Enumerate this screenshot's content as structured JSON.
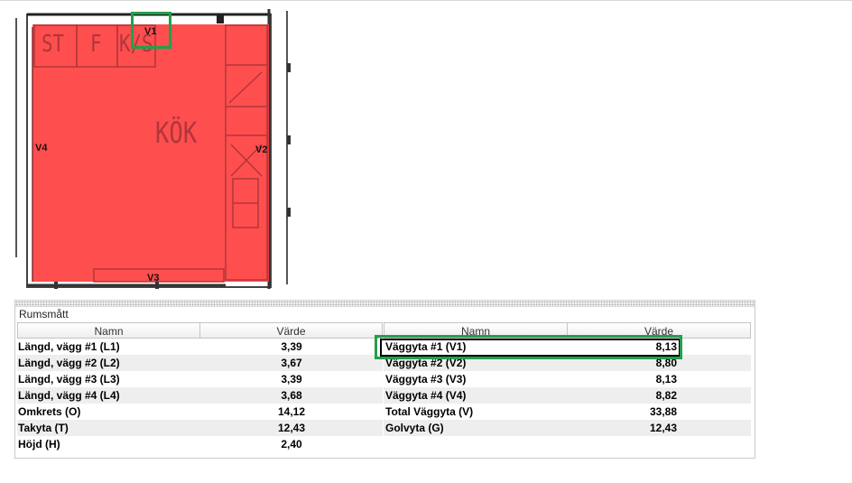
{
  "floorplan": {
    "room_label": "KÖK",
    "top_labels": [
      "ST",
      "F",
      "K/S"
    ],
    "wall_labels": {
      "v1": "V1",
      "v2": "V2",
      "v3": "V3",
      "v4": "V4"
    },
    "fill_color": "#ff3b3b",
    "highlight_color": "#22a04a"
  },
  "panel": {
    "title": "Rumsmått",
    "left_table": {
      "headers": [
        "Namn",
        "Värde"
      ],
      "rows": [
        {
          "name": "Längd, vägg #1 (L1)",
          "value": "3,39"
        },
        {
          "name": "Längd, vägg #2 (L2)",
          "value": "3,67"
        },
        {
          "name": "Längd, vägg #3 (L3)",
          "value": "3,39"
        },
        {
          "name": "Längd, vägg #4 (L4)",
          "value": "3,68"
        },
        {
          "name": "Omkrets (O)",
          "value": "14,12"
        },
        {
          "name": "Takyta (T)",
          "value": "12,43"
        },
        {
          "name": "Höjd (H)",
          "value": "2,40"
        }
      ]
    },
    "right_table": {
      "headers": [
        "Namn",
        "Värde"
      ],
      "rows": [
        {
          "name": "Väggyta #1 (V1)",
          "value": "8,13"
        },
        {
          "name": "Väggyta #2 (V2)",
          "value": "8,80"
        },
        {
          "name": "Väggyta #3 (V3)",
          "value": "8,13"
        },
        {
          "name": "Väggyta #4 (V4)",
          "value": "8,82"
        },
        {
          "name": "Total Väggyta (V)",
          "value": "33,88"
        },
        {
          "name": "Golvyta (G)",
          "value": "12,43"
        }
      ]
    }
  }
}
